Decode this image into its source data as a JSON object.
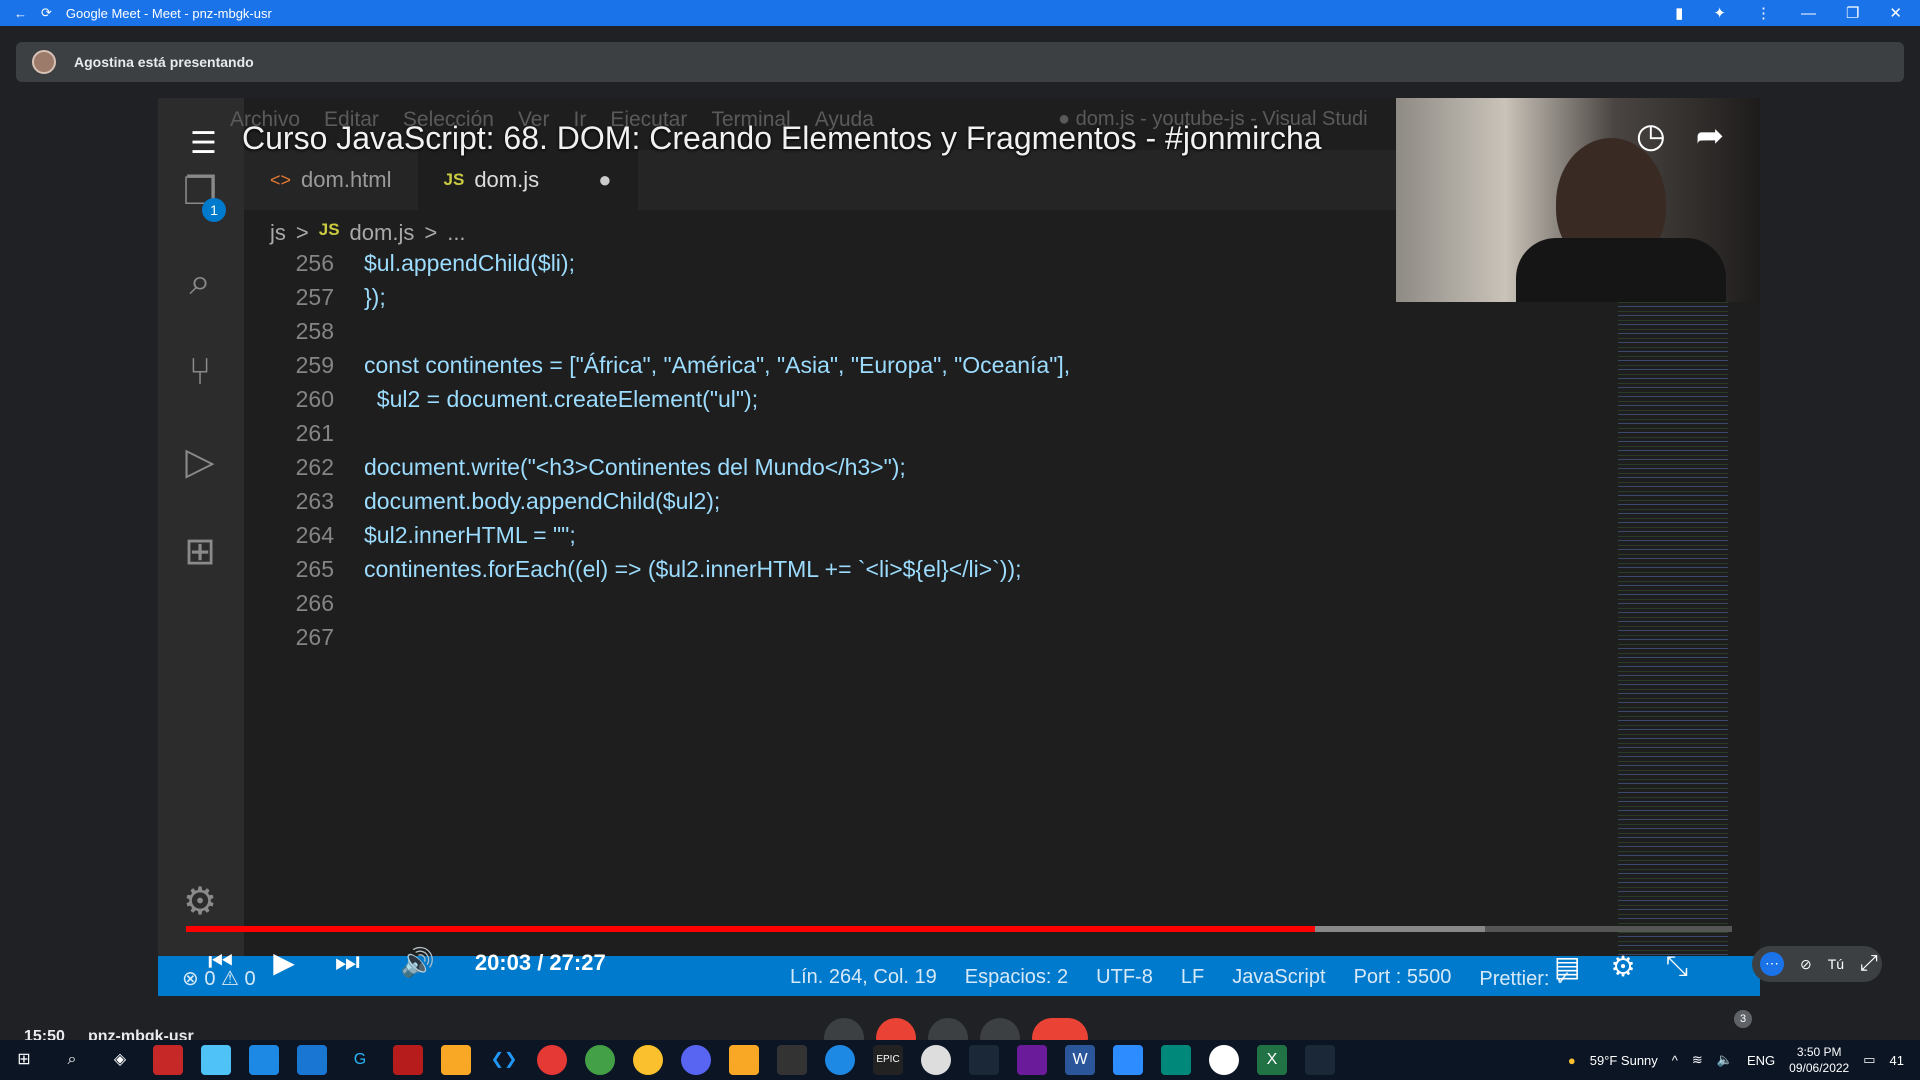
{
  "browser": {
    "title": "Google Meet - Meet - pnz-mbgk-usr"
  },
  "meet": {
    "presenting": "Agostina está presentando",
    "time": "15:50",
    "code": "pnz-mbgk-usr",
    "participants_count": "3",
    "self_label": "Tú"
  },
  "youtube": {
    "title": "Curso JavaScript: 68. DOM: Creando Elementos y Fragmentos - #jonmircha",
    "time_display": "20:03 / 27:27",
    "progress_fraction": 0.73,
    "buffer_fraction": 0.84
  },
  "vscode": {
    "menu": [
      "Archivo",
      "Editar",
      "Selección",
      "Ver",
      "Ir",
      "Ejecutar",
      "Terminal",
      "Ayuda"
    ],
    "window_title": "● dom.js - youtube-js - Visual Studi",
    "explorer_badge": "1",
    "tabs": [
      {
        "label": "dom.html",
        "badge": "<>"
      },
      {
        "label": "dom.js",
        "badge": "JS"
      }
    ],
    "breadcrumb": [
      "js",
      ">",
      "JS",
      "dom.js",
      ">",
      "..."
    ],
    "line_numbers": [
      "256",
      "257",
      "258",
      "259",
      "260",
      "261",
      "262",
      "263",
      "264",
      "265",
      "266",
      "267"
    ],
    "code_lines": [
      "$ul.appendChild($li);",
      "});",
      "",
      "const continentes = [\"África\", \"América\", \"Asia\", \"Europa\", \"Oceanía\"],",
      "  $ul2 = document.createElement(\"ul\");",
      "",
      "document.write(\"<h3>Continentes del Mundo</h3>\");",
      "document.body.appendChild($ul2);",
      "$ul2.innerHTML = \"\";",
      "continentes.forEach((el) => ($ul2.innerHTML += `<li>${el}</li>`));",
      "",
      ""
    ],
    "status": {
      "errors": "0",
      "warnings": "0",
      "position": "Lín. 264, Col. 19",
      "spaces": "Espacios: 2",
      "encoding": "UTF-8",
      "eol": "LF",
      "language": "JavaScript",
      "port": "Port : 5500",
      "prettier": "Prettier: ✓"
    }
  },
  "taskbar": {
    "weather": "59°F  Sunny",
    "lang": "ENG",
    "clock_time": "3:50 PM",
    "clock_date": "09/06/2022",
    "notifications": "41"
  },
  "colors": {
    "meet_blue": "#1a73e8",
    "vscode_status": "#007acc",
    "progress_red": "#ff0000",
    "hangup_red": "#ea4335"
  }
}
